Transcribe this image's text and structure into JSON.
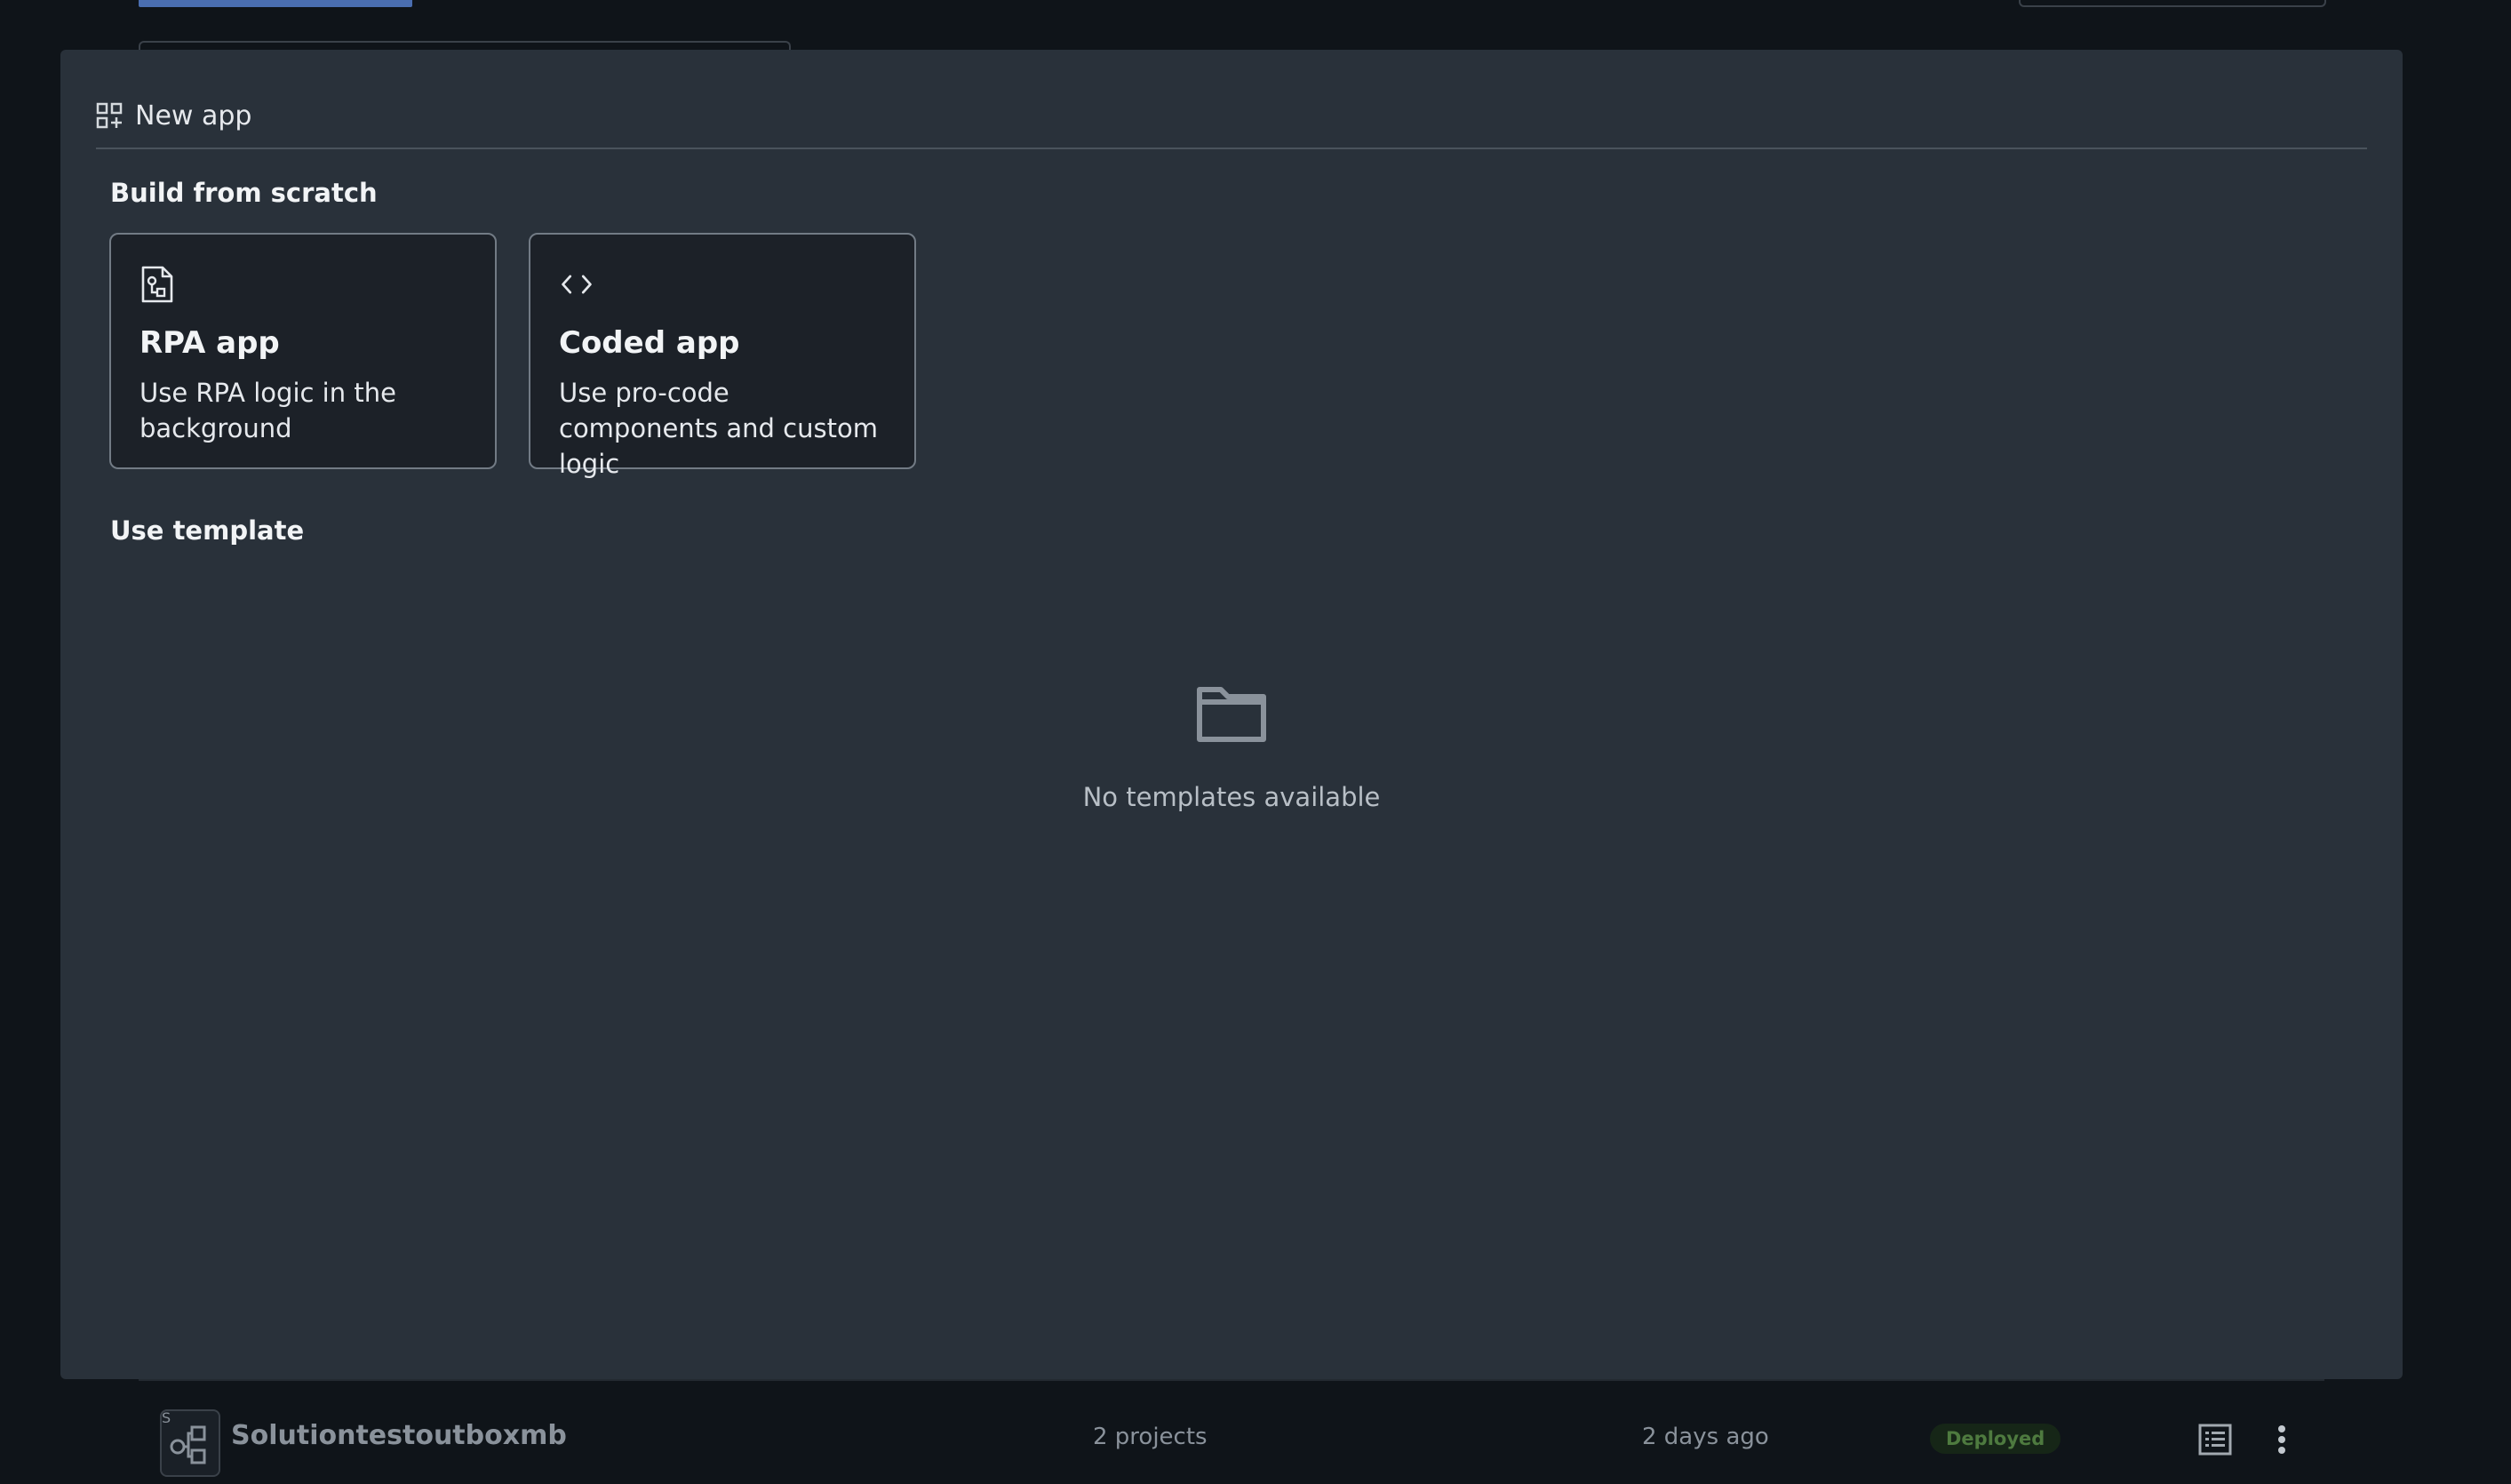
{
  "modal": {
    "title": "New app",
    "build_section_title": "Build from scratch",
    "cards": [
      {
        "title": "RPA app",
        "description": "Use RPA logic in the background",
        "icon": "rpa-document-icon"
      },
      {
        "title": "Coded app",
        "description": "Use pro-code components and custom logic",
        "icon": "code-brackets-icon"
      }
    ],
    "template_section_title": "Use template",
    "empty_state": {
      "icon": "folder-icon",
      "text": "No templates available"
    }
  },
  "background_row": {
    "avatar_letter": "S",
    "name": "Solutiontestoutboxmb",
    "projects": "2 projects",
    "updated": "2 days ago",
    "status": "Deployed"
  },
  "colors": {
    "page_bg": "#0f1419",
    "modal_bg": "#29313a",
    "card_bg": "#1c2128",
    "card_border": "#727b85",
    "status_text": "#4e7a3f",
    "accent": "#4a6eb0"
  }
}
